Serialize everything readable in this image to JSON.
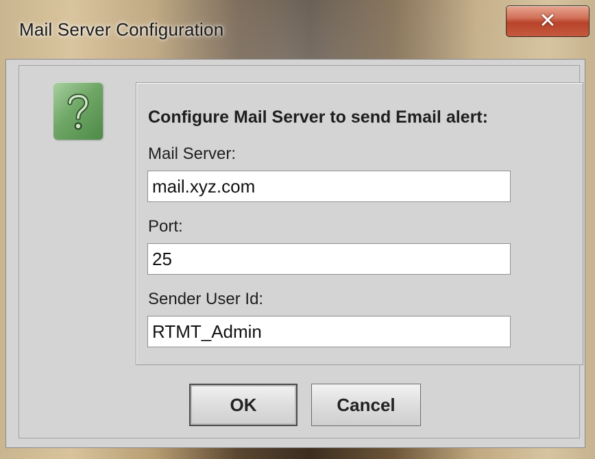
{
  "window": {
    "title": "Mail Server Configuration",
    "close_glyph": "✕"
  },
  "dialog": {
    "icon": "question-icon",
    "heading": "Configure Mail Server to send Email alert:",
    "fields": {
      "mail_server": {
        "label": "Mail Server:",
        "value": "mail.xyz.com"
      },
      "port": {
        "label": "Port:",
        "value": "25"
      },
      "sender_user_id": {
        "label": "Sender User Id:",
        "value": "RTMT_Admin"
      }
    },
    "buttons": {
      "ok_label": "OK",
      "cancel_label": "Cancel"
    }
  },
  "colors": {
    "dialog_background": "#d4d4d4",
    "icon_green": "#6fa766",
    "close_button_red": "#c45a3f"
  }
}
